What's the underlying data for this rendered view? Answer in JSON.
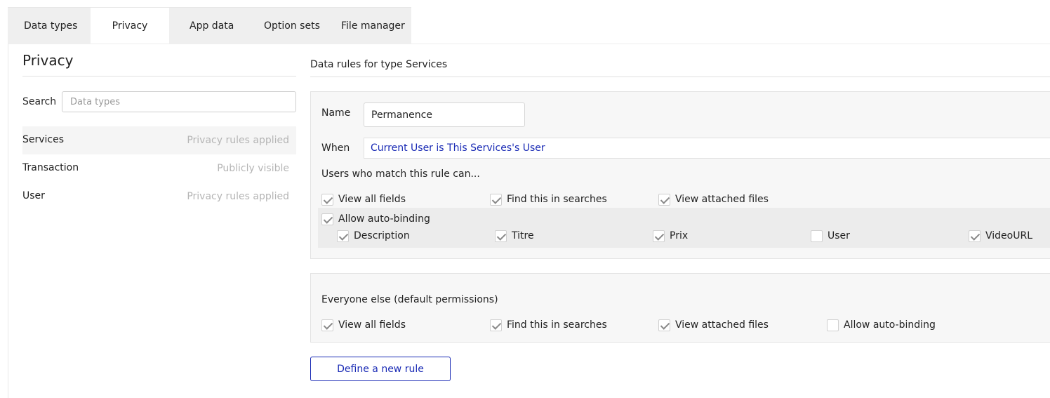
{
  "tabs": [
    {
      "label": "Data types",
      "active": false
    },
    {
      "label": "Privacy",
      "active": true
    },
    {
      "label": "App data",
      "active": false
    },
    {
      "label": "Option sets",
      "active": false
    },
    {
      "label": "File manager",
      "active": false
    }
  ],
  "left_panel": {
    "title": "Privacy",
    "search_label": "Search",
    "search_placeholder": "Data types",
    "types": [
      {
        "name": "Services",
        "status": "Privacy rules applied",
        "selected": true
      },
      {
        "name": "Transaction",
        "status": "Publicly visible",
        "selected": false
      },
      {
        "name": "User",
        "status": "Privacy rules applied",
        "selected": false
      }
    ]
  },
  "right_panel": {
    "title": "Data rules for type Services",
    "rule": {
      "name_label": "Name",
      "name_value": "Permanence",
      "when_label": "When",
      "when_value": "Current User is This Services's User",
      "permissions_heading": "Users who match this rule can...",
      "permissions": [
        {
          "label": "View all fields",
          "checked": true
        },
        {
          "label": "Find this in searches",
          "checked": true
        },
        {
          "label": "View attached files",
          "checked": true
        }
      ],
      "auto_binding": {
        "label": "Allow auto-binding",
        "checked": true
      },
      "fields": [
        {
          "label": "Description",
          "checked": true
        },
        {
          "label": "Titre",
          "checked": true
        },
        {
          "label": "Prix",
          "checked": true
        },
        {
          "label": "User",
          "checked": false
        },
        {
          "label": "VideoURL",
          "checked": true
        }
      ]
    },
    "default_rule": {
      "heading": "Everyone else (default permissions)",
      "permissions": [
        {
          "label": "View all fields",
          "checked": true
        },
        {
          "label": "Find this in searches",
          "checked": true
        },
        {
          "label": "View attached files",
          "checked": true
        },
        {
          "label": "Allow auto-binding",
          "checked": false
        }
      ]
    },
    "new_rule_button": "Define a new rule"
  },
  "colors": {
    "accent": "#1a2bb5",
    "muted_text": "#b5b5b5",
    "panel_bg": "#f7f7f7"
  }
}
